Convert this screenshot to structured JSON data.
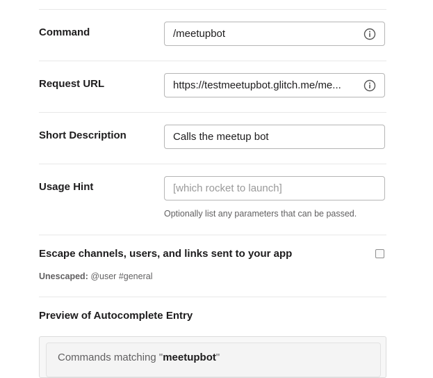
{
  "form": {
    "command": {
      "label": "Command",
      "value": "/meetupbot"
    },
    "request_url": {
      "label": "Request URL",
      "value": "https://testmeetupbot.glitch.me/me..."
    },
    "short_description": {
      "label": "Short Description",
      "value": "Calls the meetup bot"
    },
    "usage_hint": {
      "label": "Usage Hint",
      "placeholder": "[which rocket to launch]",
      "help": "Optionally list any parameters that can be passed."
    },
    "escape": {
      "title": "Escape channels, users, and links sent to your app",
      "unescaped_label": "Unescaped:",
      "unescaped_example": "@user #general",
      "checked": false
    }
  },
  "preview": {
    "title": "Preview of Autocomplete Entry",
    "matching_prefix": "Commands matching \"",
    "matching_term": "meetupbot",
    "matching_suffix": "\""
  },
  "icons": {
    "info": "info-circle-icon",
    "checkbox": "checkbox-icon"
  }
}
